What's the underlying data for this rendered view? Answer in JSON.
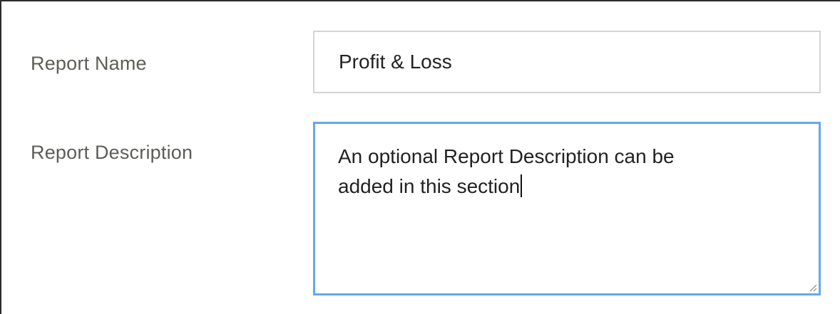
{
  "form": {
    "report_name": {
      "label": "Report Name",
      "value": "Profit & Loss"
    },
    "report_description": {
      "label": "Report Description",
      "line1": "An optional Report Description can be",
      "line2": "added in this section"
    }
  },
  "colors": {
    "label_text": "#5d5d58",
    "input_border": "#d4d4d4",
    "focus_border": "#64a9e8",
    "value_text": "#222222"
  },
  "icons": {
    "resize_handle": "resize-grip-icon"
  }
}
